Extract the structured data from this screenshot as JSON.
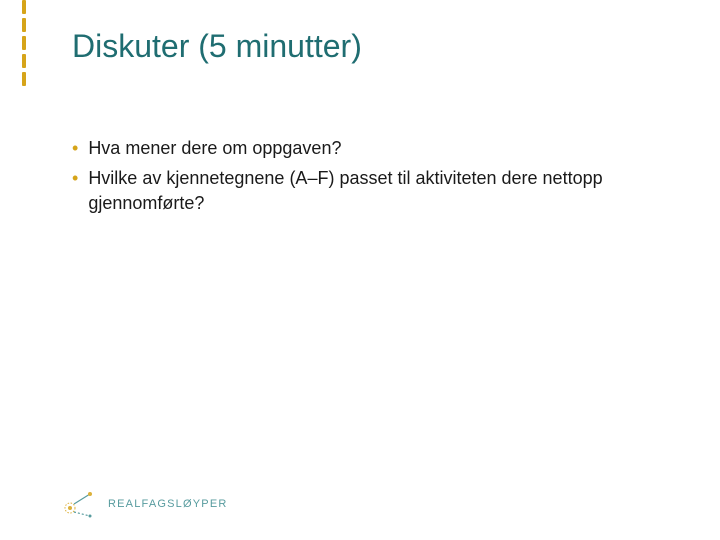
{
  "title": "Diskuter (5 minutter)",
  "bullets": [
    "Hva mener dere om oppgaven?",
    "Hvilke av kjennetegnene (A–F) passet til aktiviteten dere nettopp gjennomførte?"
  ],
  "logo_text": "REALFAGSLØYPER",
  "accent_color": "#d6a419",
  "title_color": "#1f6d71"
}
